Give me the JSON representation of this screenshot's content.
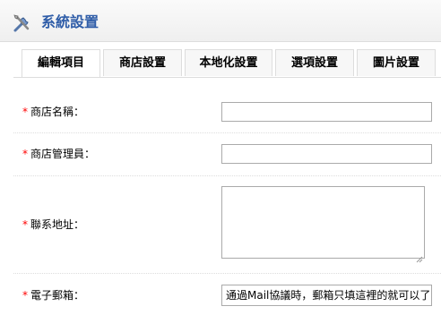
{
  "header": {
    "title": "系統設置",
    "icon": "tools-icon"
  },
  "tabs": [
    {
      "label": "編輯項目",
      "active": true
    },
    {
      "label": "商店設置",
      "active": false
    },
    {
      "label": "本地化設置",
      "active": false
    },
    {
      "label": "選項設置",
      "active": false
    },
    {
      "label": "圖片設置",
      "active": false
    }
  ],
  "form": {
    "required_mark": "*",
    "store_name": {
      "label": "商店名稱：",
      "value": ""
    },
    "store_owner": {
      "label": "商店管理員：",
      "value": ""
    },
    "address": {
      "label": "聯系地址：",
      "value": ""
    },
    "email": {
      "label": "電子郵箱：",
      "value": "通過Mail協議時，郵箱只填這裡的就可以了"
    }
  },
  "colors": {
    "title": "#2f5da8",
    "required": "#ff0000"
  }
}
